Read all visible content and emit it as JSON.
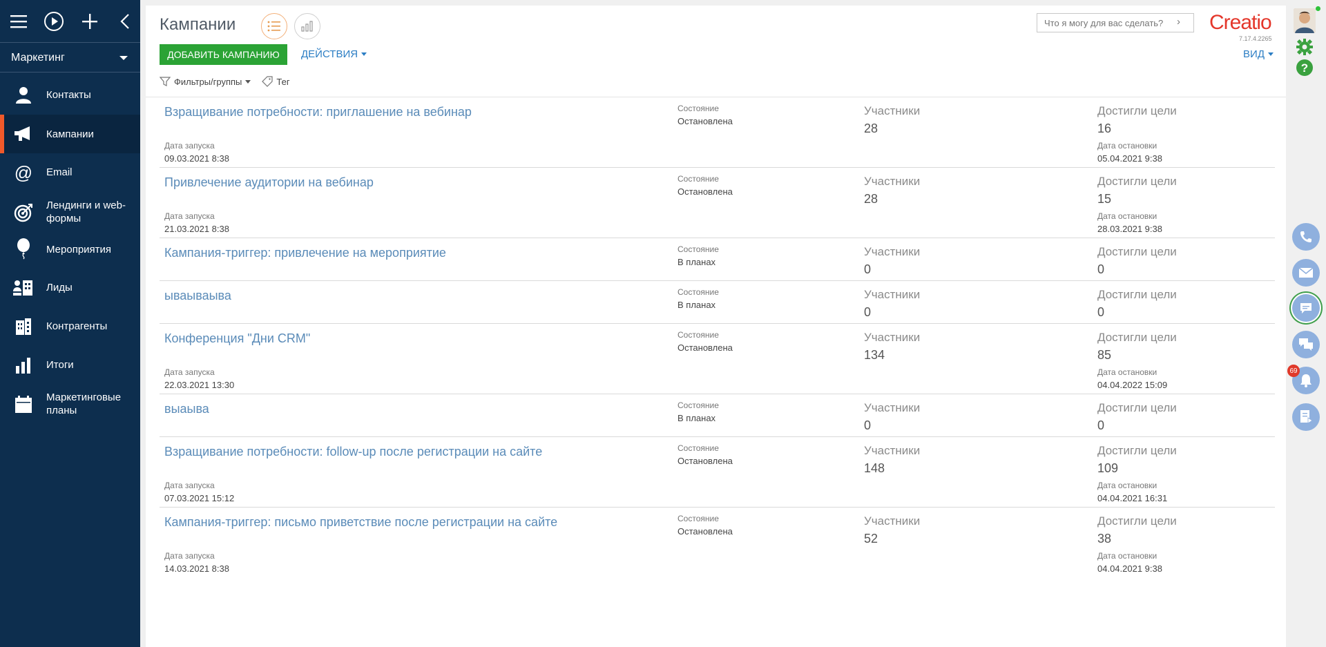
{
  "sidebar": {
    "workspace": "Маркетинг",
    "items": [
      {
        "label": "Контакты",
        "icon": "person-icon"
      },
      {
        "label": "Кампании",
        "icon": "megaphone-icon",
        "active": true
      },
      {
        "label": "Email",
        "icon": "at-icon"
      },
      {
        "label": "Лендинги и web-формы",
        "icon": "target-icon"
      },
      {
        "label": "Мероприятия",
        "icon": "balloon-icon"
      },
      {
        "label": "Лиды",
        "icon": "leads-icon"
      },
      {
        "label": "Контрагенты",
        "icon": "building-icon"
      },
      {
        "label": "Итоги",
        "icon": "bar-chart-icon"
      },
      {
        "label": "Маркетинговые планы",
        "icon": "calendar-icon"
      }
    ]
  },
  "header": {
    "title": "Кампании",
    "search_placeholder": "Что я могу для вас сделать?",
    "logo": "Creatio",
    "version": "7.17.4.2265"
  },
  "toolbar": {
    "add_label": "Добавить кампанию",
    "actions_label": "Действия",
    "view_label": "Вид",
    "filters_label": "Фильтры/группы",
    "tag_label": "Тег"
  },
  "labels": {
    "state": "Состояние",
    "participants": "Участники",
    "goal": "Достигли цели",
    "start_date": "Дата запуска",
    "stop_date": "Дата остановки"
  },
  "campaigns": [
    {
      "name": "Взращивание потребности: приглашение на вебинар",
      "state": "Остановлена",
      "participants": "28",
      "goal": "16",
      "start": "09.03.2021 8:38",
      "stop": "05.04.2021 9:38"
    },
    {
      "name": "Привлечение аудитории на вебинар",
      "state": "Остановлена",
      "participants": "28",
      "goal": "15",
      "start": "21.03.2021 8:38",
      "stop": "28.03.2021 9:38"
    },
    {
      "name": "Кампания-триггер: привлечение на мероприятие",
      "state": "В планах",
      "participants": "0",
      "goal": "0"
    },
    {
      "name": "ываываыва",
      "state": "В планах",
      "participants": "0",
      "goal": "0"
    },
    {
      "name": "Конференция \"Дни CRM\"",
      "state": "Остановлена",
      "participants": "134",
      "goal": "85",
      "start": "22.03.2021 13:30",
      "stop": "04.04.2022 15:09"
    },
    {
      "name": "выаыва",
      "state": "В планах",
      "participants": "0",
      "goal": "0"
    },
    {
      "name": "Взращивание потребности: follow-up после регистрации на сайте",
      "state": "Остановлена",
      "participants": "148",
      "goal": "109",
      "start": "07.03.2021 15:12",
      "stop": "04.04.2021 16:31"
    },
    {
      "name": "Кампания-триггер: письмо приветствие после регистрации на сайте",
      "state": "Остановлена",
      "participants": "52",
      "goal": "38",
      "start": "14.03.2021 8:38",
      "stop": "04.04.2021 9:38"
    }
  ],
  "rightbar": {
    "notifications_count": "69"
  },
  "colors": {
    "sidebar_bg": "#0d2e4e",
    "accent_orange": "#f0592a",
    "add_button": "#2ba335",
    "link_blue": "#2c7ec4",
    "logo_red": "#e4372b"
  }
}
